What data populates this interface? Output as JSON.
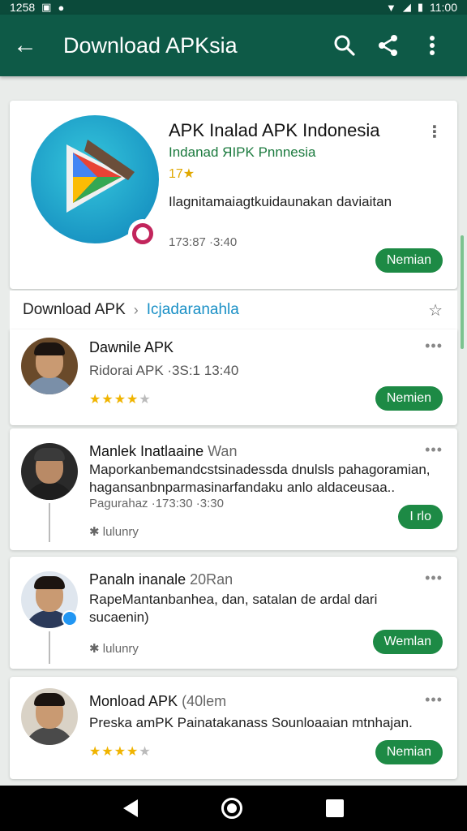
{
  "status_bar": {
    "time_left": "1258",
    "time_right": "11:00"
  },
  "app_bar": {
    "title": "Download APKsia"
  },
  "app_card": {
    "title": "APK Inalad APK Indonesia",
    "subtitle": "Indanad ЯIPK Pnnnesia",
    "rating": "17★",
    "description": "Ilagnitamaiagtkuidaunakan daviaitan",
    "meta": "173:87 ·3:40",
    "button_label": "Nemian"
  },
  "section": {
    "crumb": "Download APK",
    "link": "Icjadaranahla"
  },
  "reviews": [
    {
      "name": "Dawnile APK",
      "text": "Ridorai APK ·3S:1 13:40",
      "stars": 4,
      "button_label": "Nemien"
    },
    {
      "name": "Manlek Inatlaaine",
      "name_secondary": "Wan",
      "text": "Maporkanbemandcstsinadessda dnulsls pahagoramian, hagansanbnparmasinarfandaku anlo aldaceusaa..",
      "meta": "Pagurahaz  ·173:30 ·3:30",
      "footer": "✱ lulunry",
      "button_label": "I rlo"
    },
    {
      "name": "Panaln inanale",
      "name_secondary": "20Ran",
      "text": "RapeMantanbanhea, dan, satalan de ardal dari sucaenin)",
      "footer": "✱ lulunry",
      "button_label": "Wemlan"
    },
    {
      "name": "Monload APK",
      "name_secondary": "(40lem",
      "text": "Preska amPK Painatakanass Sounloaaian mtnhajan.",
      "stars": 4,
      "button_label": "Nemian"
    }
  ],
  "colors": {
    "appbar": "#0e5a47",
    "accent_green": "#1d8a45",
    "link_blue": "#1a90c6"
  }
}
